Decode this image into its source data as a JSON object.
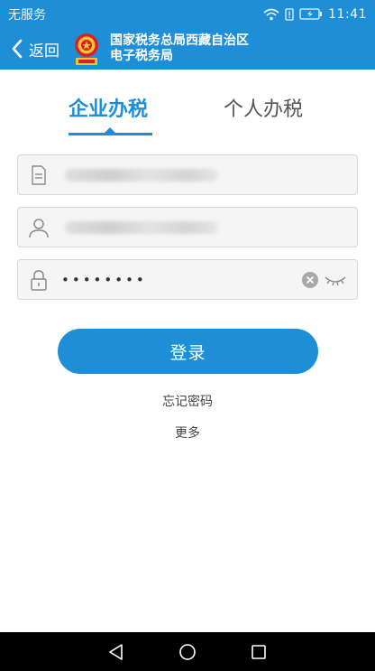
{
  "status_bar": {
    "carrier": "无服务",
    "time": "11:41"
  },
  "header": {
    "back_label": "返回",
    "title_line1": "国家税务总局西藏自治区",
    "title_line2": "电子税务局"
  },
  "tabs": [
    {
      "label": "企业办税",
      "active": true
    },
    {
      "label": "个人办税",
      "active": false
    }
  ],
  "form": {
    "tax_id_value": "",
    "username_value": "",
    "password_dots": "••••••••"
  },
  "actions": {
    "login_label": "登录",
    "forgot_label": "忘记密码",
    "more_label": "更多"
  },
  "colors": {
    "brand": "#1e8fd6"
  }
}
